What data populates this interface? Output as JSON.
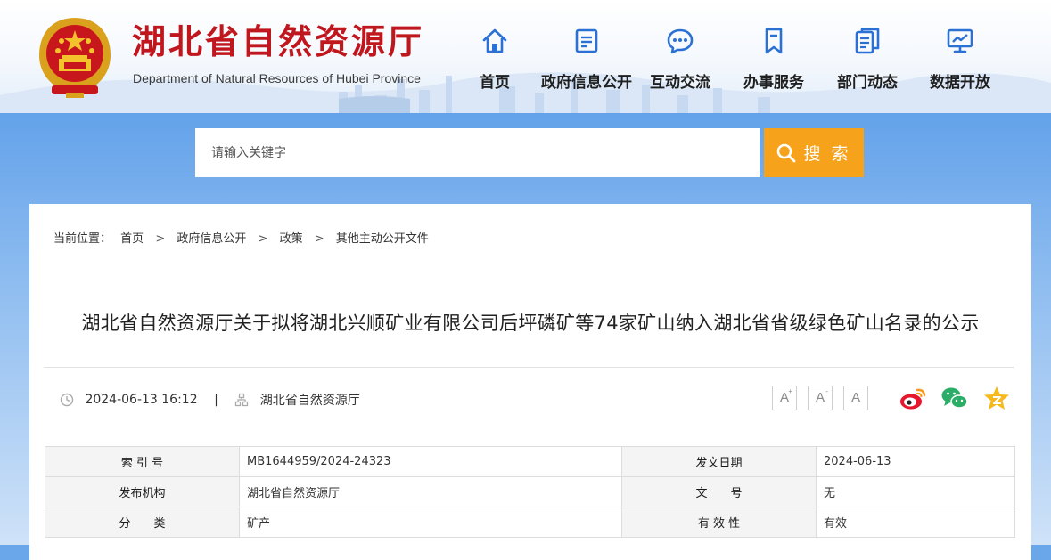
{
  "header": {
    "site_title": "湖北省自然资源厅",
    "site_subtitle": "Department of Natural Resources of Hubei Province",
    "nav": [
      {
        "label": "首页",
        "icon": "home-icon"
      },
      {
        "label": "政府信息公开",
        "icon": "document-list-icon"
      },
      {
        "label": "互动交流",
        "icon": "chat-bubble-icon"
      },
      {
        "label": "办事服务",
        "icon": "bookmark-icon"
      },
      {
        "label": "部门动态",
        "icon": "news-pages-icon"
      },
      {
        "label": "数据开放",
        "icon": "data-screen-icon"
      }
    ]
  },
  "search": {
    "placeholder": "请输入关键字",
    "button_label": "搜 索",
    "accent": "#f7a21b"
  },
  "breadcrumb": {
    "prefix": "当前位置：",
    "items": [
      "首页",
      "政府信息公开",
      "政策",
      "其他主动公开文件"
    ],
    "separator": ">"
  },
  "article": {
    "title": "湖北省自然资源厅关于拟将湖北兴顺矿业有限公司后坪磷矿等74家矿山纳入湖北省省级绿色矿山名录的公示",
    "datetime": "2024-06-13 16:12",
    "pipe": "|",
    "source": "湖北省自然资源厅"
  },
  "tools": {
    "font_letter": "A",
    "font_increase_sign": "+",
    "font_decrease_sign": "-",
    "share_icons": [
      "weibo-icon",
      "wechat-icon",
      "favorite-star-icon"
    ]
  },
  "info_table": {
    "rows": [
      [
        {
          "k": "索 引 号",
          "v": "MB1644959/2024-24323"
        },
        {
          "k": "发文日期",
          "v": "2024-06-13"
        }
      ],
      [
        {
          "k": "发布机构",
          "v": "湖北省自然资源厅"
        },
        {
          "k": "文　　号",
          "v": "无"
        }
      ],
      [
        {
          "k": "分　　类",
          "v": "矿产"
        },
        {
          "k": "有 效 性",
          "v": "有效"
        }
      ]
    ]
  },
  "colors": {
    "brand_red": "#c0161d",
    "nav_blue": "#2b71d4",
    "band_blue": "#63a2ea"
  }
}
